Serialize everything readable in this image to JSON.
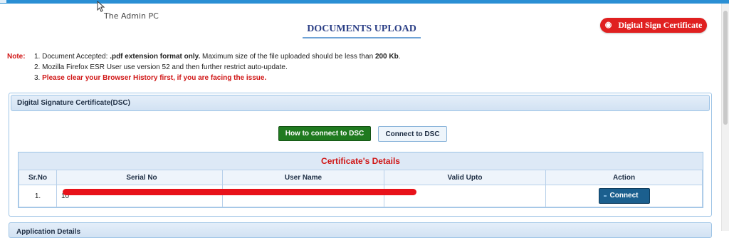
{
  "header": {
    "pc_label": "The Admin PC",
    "page_title": "DOCUMENTS UPLOAD",
    "dsc_button_label": "Digital Sign Certificate"
  },
  "note": {
    "label": "Note:",
    "items": [
      {
        "n": "1.",
        "t1": "Document Accepted: ",
        "b1": ".pdf extension format only.",
        "t2": " Maximum size of the file uploaded should be less than ",
        "b2": "200 Kb",
        "t3": "."
      },
      {
        "n": "2.",
        "text": "Mozilla Firefox ESR User use version 52 and then further restrict auto-update."
      },
      {
        "n": "3.",
        "text": "Please clear your Browser History first, if you are facing the issue."
      }
    ]
  },
  "dsc_panel": {
    "title": "Digital Signature Certificate(DSC)",
    "howto_button": "How to connect to DSC",
    "connect_button": "Connect to DSC",
    "cert_title": "Certificate's Details",
    "columns": [
      "Sr.No",
      "Serial No",
      "User Name",
      "Valid Upto",
      "Action"
    ],
    "rows": [
      {
        "srno": "1.",
        "serial": "10",
        "user": "",
        "valid": "",
        "action": "Connect"
      }
    ]
  },
  "next_panel": {
    "title": "Application Details"
  },
  "colors": {
    "accent_blue": "#2a8fd4",
    "red": "#d01515",
    "green_button": "#1f7a1f",
    "connect_button": "#1b5f8e"
  },
  "icons": [
    "cursor-icon",
    "eye-icon",
    "plug-icon"
  ]
}
